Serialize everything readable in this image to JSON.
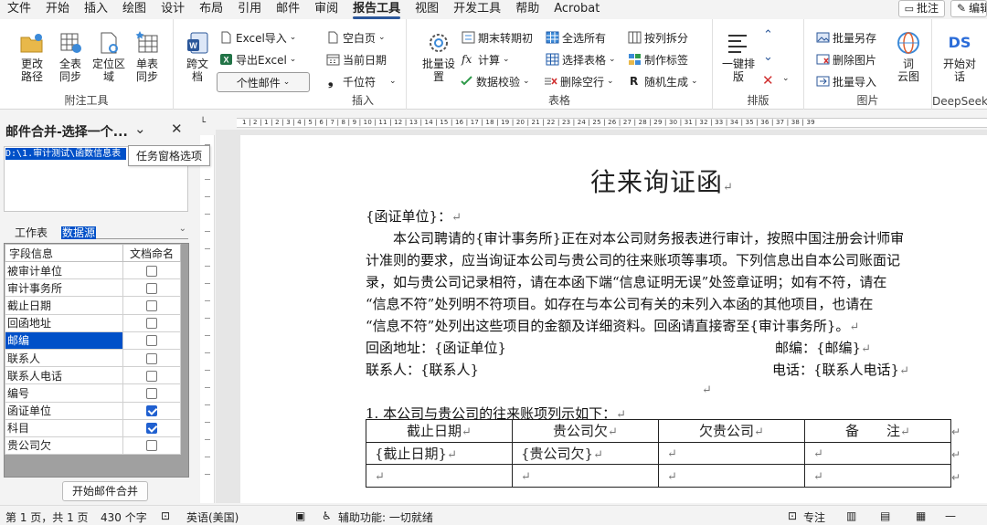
{
  "menu": {
    "tabs": [
      "文件",
      "开始",
      "插入",
      "绘图",
      "设计",
      "布局",
      "引用",
      "邮件",
      "审阅",
      "报告工具",
      "视图",
      "开发工具",
      "帮助",
      "Acrobat"
    ],
    "active_tab": "报告工具",
    "comments_button": "批注",
    "edit_button": "编辑"
  },
  "ribbon": {
    "groups": {
      "attach_tools": "附注工具",
      "insert": "插入",
      "table": "表格",
      "sort": "排版",
      "image": "图片",
      "deepseek": "DeepSeek"
    },
    "attach": {
      "change_path": "更改\n路径",
      "full_sync": "全表\n同步",
      "locate_area": "定位区\n域",
      "single_sync": "单表\n同步"
    },
    "cross_doc": "跨文\n档",
    "excel_import": "Excel导入",
    "excel_export": "导出Excel",
    "personal_mail": "个性邮件",
    "insert": {
      "blank_page": "空白页",
      "current_date": "当前日期",
      "thousands": "千位符"
    },
    "batch_setup": "批量设\n置",
    "table": {
      "period_transfer": "期末转期初",
      "select_all": "全选所有",
      "split_by_col": "按列拆分",
      "calculate": "计算",
      "select_table": "选择表格",
      "make_label": "制作标签",
      "data_validate": "数据校验",
      "delete_blank_row": "删除空行",
      "random_gen": "随机生成"
    },
    "one_key_format": "一键排\n版",
    "image": {
      "batch_save_as": "批量另存",
      "delete_image": "删除图片",
      "batch_import": "批量导入"
    },
    "word_cloud": "词\n云图",
    "start_dialog": "开始对\n话",
    "ds_logo": "DS"
  },
  "pane": {
    "title": "邮件合并-选择一个...",
    "path_value": "D:\\1.审计测试\\函数信息表",
    "tooltip": "任务窗格选项",
    "worksheet_label": "工作表",
    "worksheet_value": "数据源",
    "col_field": "字段信息",
    "col_docname": "文档命名",
    "fields": [
      {
        "name": "被审计单位",
        "checked": false,
        "selected": false
      },
      {
        "name": "审计事务所",
        "checked": false,
        "selected": false
      },
      {
        "name": "截止日期",
        "checked": false,
        "selected": false
      },
      {
        "name": "回函地址",
        "checked": false,
        "selected": false
      },
      {
        "name": "邮编",
        "checked": false,
        "selected": true
      },
      {
        "name": "联系人",
        "checked": false,
        "selected": false
      },
      {
        "name": "联系人电话",
        "checked": false,
        "selected": false
      },
      {
        "name": "编号",
        "checked": false,
        "selected": false
      },
      {
        "name": "函证单位",
        "checked": true,
        "selected": false
      },
      {
        "name": "科目",
        "checked": true,
        "selected": false
      },
      {
        "name": "贵公司欠",
        "checked": false,
        "selected": false
      }
    ],
    "start_button": "开始邮件合并"
  },
  "ruler_numbers": "1 | 2 | 1 | 2 | 3 | 4 | 5 | 6 | 7 | 8 | 9 | 10 | 11 | 12 | 13 | 14 | 15 | 16 | 17 | 18 | 19 | 20 | 21 | 22 | 23 | 24 | 25 | 26 | 27 | 28 | 29 | 30 | 31 | 32 | 33 | 34 | 35 | 36 | 37 | 38 | 39",
  "document": {
    "title": "往来询证函",
    "salutation": "{函证单位}：",
    "body_lines": [
      "本公司聘请的{审计事务所}正在对本公司财务报表进行审计，按照中国注册会计师审",
      "计准则的要求，应当询证本公司与贵公司的往来账项等事项。下列信息出自本公司账面记",
      "录，如与贵公司记录相符，请在本函下端“信息证明无误”处签章证明；如有不符，请在",
      "“信息不符”处列明不符项目。如存在与本公司有关的未列入本函的其他项目，也请在",
      "“信息不符”处列出这些项目的金额及详细资料。回函请直接寄至{审计事务所}。"
    ],
    "address_label": "回函地址：{函证单位}",
    "zip_label": "邮编：{邮编}",
    "contact_label": "联系人：{联系人}",
    "phone_label": "电话：{联系人电话}",
    "list_heading": "1.  本公司与贵公司的往来账项列示如下：",
    "table_headers": [
      "截止日期",
      "贵公司欠",
      "欠贵公司",
      "备　　注"
    ],
    "table_row1": [
      "{截止日期}",
      "{贵公司欠}",
      "",
      ""
    ],
    "paragraph_mark": "↵"
  },
  "status": {
    "page": "第 1 页，共 1 页",
    "words": "430 个字",
    "language": "英语(美国)",
    "accessibility": "辅助功能: 一切就绪",
    "focus": "专注"
  }
}
